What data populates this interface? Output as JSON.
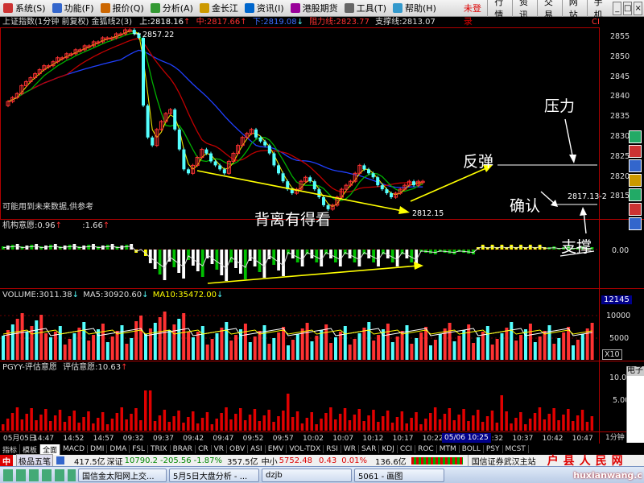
{
  "menu": {
    "items": [
      "系统(S)",
      "功能(F)",
      "报价(Q)",
      "分析(A)",
      "金长江",
      "资讯(I)",
      "港股期货",
      "工具(T)",
      "帮助(H)"
    ],
    "status": "交易未登录",
    "right_buttons": [
      "行情",
      "资讯",
      "交易",
      "网站",
      "手机"
    ]
  },
  "main_info": {
    "title": "上证指数(1分钟 前复权) 金狐线2(3)",
    "up_label": "上:2818.16",
    "up_arrow": "↑",
    "mid_label": "中:2817.66",
    "mid_arrow": "↑",
    "down_label": "下:2819.08",
    "down_arrow": "↓",
    "resist_label": "阻力线:2823.77",
    "support_label": "支撑线:2813.07",
    "corner": "CI"
  },
  "y_axis_main": [
    "2855",
    "2850",
    "2845",
    "2840",
    "2835",
    "2830",
    "2825",
    "2820",
    "2815"
  ],
  "price_marks": {
    "high": "2857.22",
    "low": "2812.15",
    "last": "2817.13-2"
  },
  "warning": "可能用到未来数据,供参考",
  "indicator1": {
    "label": "机构意愿",
    "v1": ":0.96",
    "arr1": "↑",
    "v2": ":1.66",
    "arr2": "↑",
    "y": "0.00"
  },
  "volume": {
    "label": "VOLUME:3011.38",
    "arr0": "↓",
    "ma5": "MA5:30920.60",
    "arr1": "↓",
    "ma10": "MA10:35472.00",
    "arr2": "↓",
    "y_top": "12145",
    "y_mid": "10000",
    "y_low": "5000",
    "unit": "X10"
  },
  "indicator2": {
    "label": "PGYY-评估意愿",
    "value": "评估意愿:10.63",
    "arr": "↑",
    "y_top": "10.00",
    "y_mid": "5.00"
  },
  "time_axis": [
    "05月05日",
    "14:47",
    "14:52",
    "14:57",
    "09:32",
    "09:37",
    "09:42",
    "09:47",
    "09:52",
    "09:57",
    "10:02",
    "10:07",
    "10:12",
    "10:17",
    "10:22",
    "10:27",
    "10:32",
    "10:37",
    "10:42",
    "10:47"
  ],
  "cursor_time": "05/06 10:25",
  "annotations": {
    "divergence": "背离有得看",
    "rebound": "反弹",
    "pressure": "压力",
    "confirm": "确认",
    "support": "支撑"
  },
  "tabs": [
    "指标",
    "模板",
    "全面",
    "MACD",
    "DMI",
    "DMA",
    "FSL",
    "TRIX",
    "BRAR",
    "CR",
    "VR",
    "OBV",
    "ASI",
    "EMV",
    "VOL-TDX",
    "RSI",
    "WR",
    "SAR",
    "KDJ",
    "CCI",
    "ROC",
    "MTM",
    "BOLL",
    "PSY",
    "MCST"
  ],
  "right_panel": {
    "label": "电子",
    "period": "1分钟"
  },
  "ticker": {
    "name": "极品五笔",
    "a": "417.5亿",
    "sz_label": "深证",
    "sz_val": "10790.2",
    "sz_chg": "-205.56",
    "sz_pct": "-1.87%",
    "b": "357.5亿",
    "zx_label": "中小",
    "zx_val": "5752.48",
    "zx_chg": "0.43",
    "zx_pct": "0.01%",
    "c": "136.6亿",
    "broker": "国信证券武汉主站",
    "logo": "户县人民网"
  },
  "taskbar": {
    "t1": "国信金太阳网上交...",
    "t2": "5月5日大盘分析 - ...",
    "t3": "dzjb",
    "t4": "5061 - 画图",
    "watermark": "huxianwang.c"
  },
  "colors": {
    "up": "#ff3232",
    "down": "#54ffff",
    "green": "#00c000",
    "yellow": "#ffff00"
  }
}
